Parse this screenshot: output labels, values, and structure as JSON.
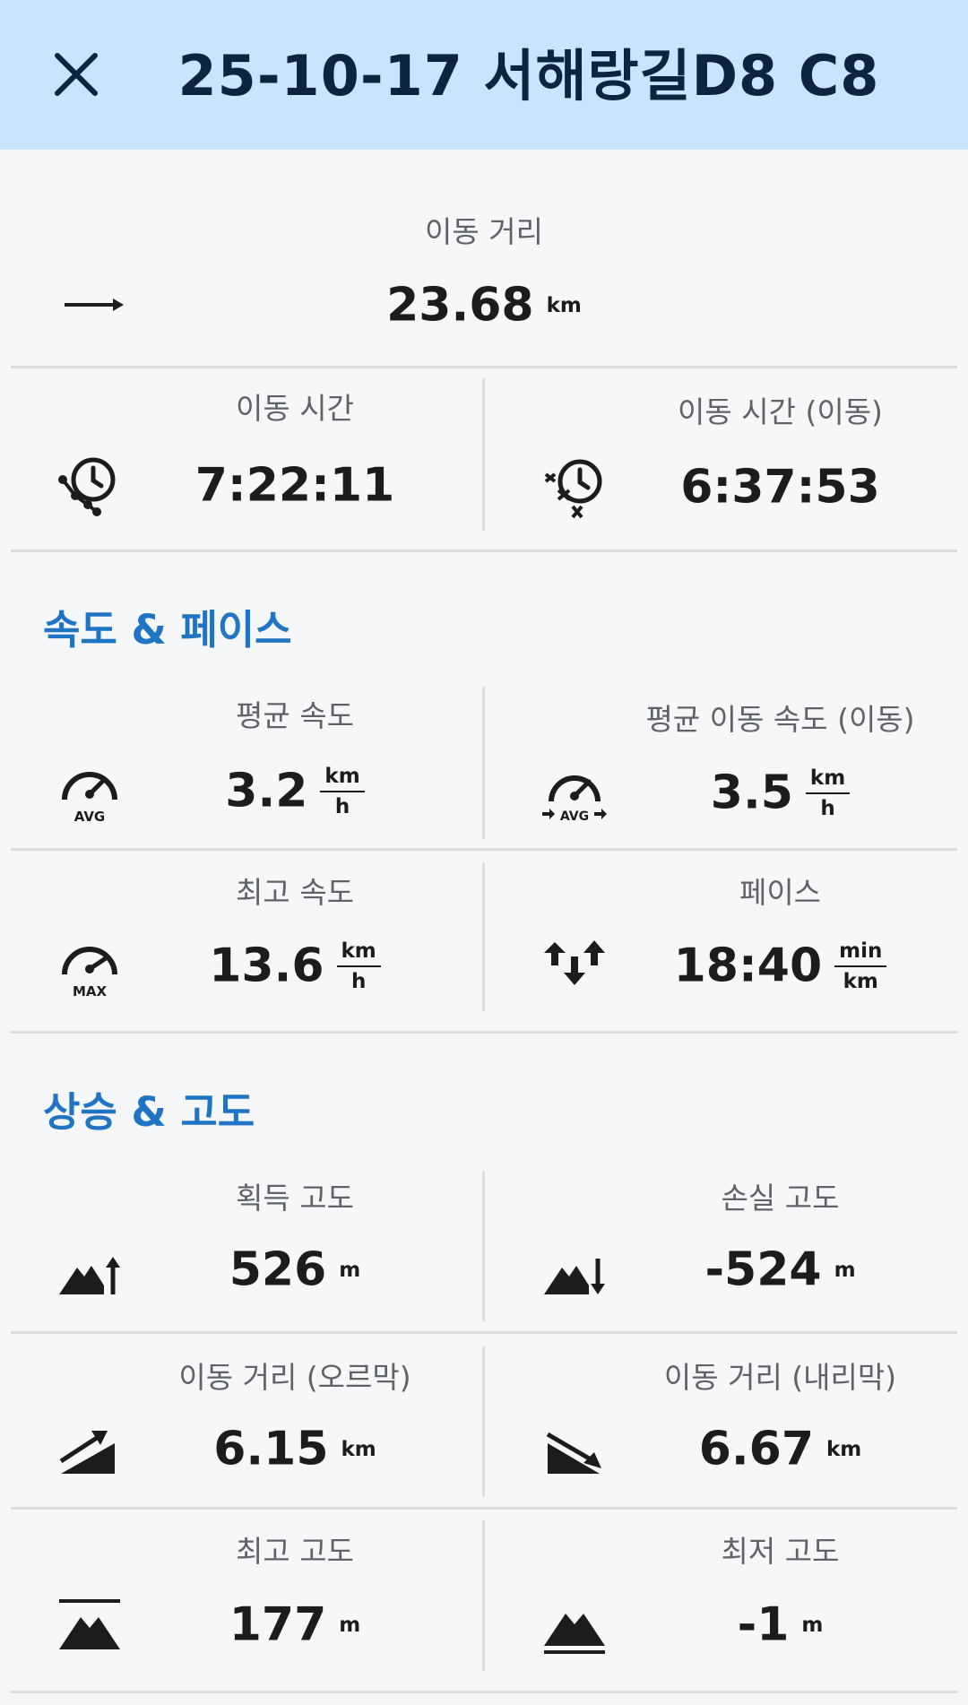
{
  "header": {
    "title": "25-10-17 서해랑길D8 C8"
  },
  "distance": {
    "label": "이동 거리",
    "value": "23.68",
    "unit": "km",
    "icon": "arrow-right-icon"
  },
  "time_total": {
    "label": "이동 시간",
    "value": "7:22:11",
    "icon": "clock-path-icon"
  },
  "time_moving": {
    "label": "이동 시간 (이동)",
    "value": "6:37:53",
    "icon": "clock-moving-icon"
  },
  "speed_section": {
    "title": "속도 & 페이스"
  },
  "avg_speed": {
    "label": "평균 속도",
    "value": "3.2",
    "unit_top": "km",
    "unit_bottom": "h",
    "icon": "speedometer-avg-icon",
    "badge": "AVG"
  },
  "avg_moving_speed": {
    "label": "평균 이동 속도 (이동)",
    "value": "3.5",
    "unit_top": "km",
    "unit_bottom": "h",
    "icon": "speedometer-avg-moving-icon",
    "badge": "AVG"
  },
  "max_speed": {
    "label": "최고 속도",
    "value": "13.6",
    "unit_top": "km",
    "unit_bottom": "h",
    "icon": "speedometer-max-icon",
    "badge": "MAX"
  },
  "pace": {
    "label": "페이스",
    "value": "18:40",
    "unit_top": "min",
    "unit_bottom": "km",
    "icon": "pace-arrows-icon"
  },
  "elevation_section": {
    "title": "상승 & 고도"
  },
  "elev_gain": {
    "label": "획득 고도",
    "value": "526",
    "unit": "m",
    "icon": "mountain-up-icon"
  },
  "elev_loss": {
    "label": "손실 고도",
    "value": "-524",
    "unit": "m",
    "icon": "mountain-down-icon"
  },
  "dist_uphill": {
    "label": "이동 거리 (오르막)",
    "value": "6.15",
    "unit": "km",
    "icon": "uphill-slope-icon"
  },
  "dist_downhill": {
    "label": "이동 거리 (내리막)",
    "value": "6.67",
    "unit": "km",
    "icon": "downhill-slope-icon"
  },
  "max_elev": {
    "label": "최고 고도",
    "value": "177",
    "unit": "m",
    "icon": "mountain-max-icon"
  },
  "min_elev": {
    "label": "최저 고도",
    "value": "-1",
    "unit": "m",
    "icon": "mountain-min-icon"
  },
  "colors": {
    "header_bg": "#c9e4fd",
    "title": "#0d2440",
    "section": "#1f74c4",
    "label": "#5f6368",
    "divider": "#dcdde0"
  }
}
